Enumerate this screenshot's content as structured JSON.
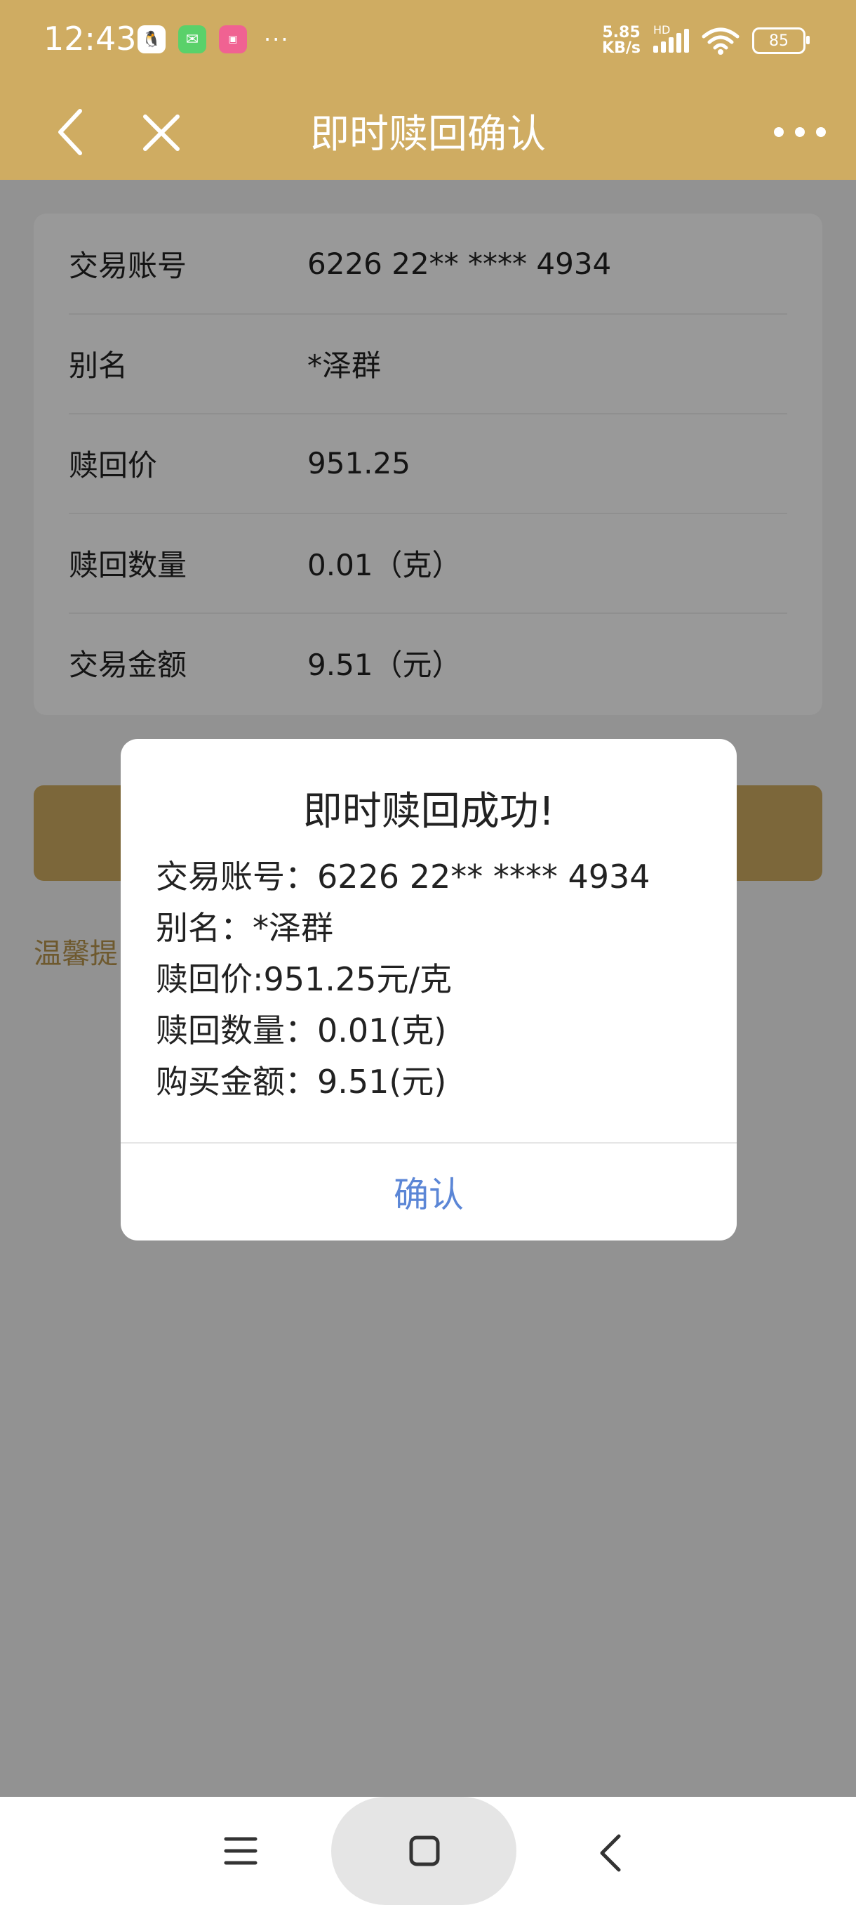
{
  "status_bar": {
    "time": "12:43",
    "speed_value": "5.85",
    "speed_unit": "KB/s",
    "network_label": "HD",
    "battery": "85",
    "more_notifications": "···"
  },
  "header": {
    "title": "即时赎回确认"
  },
  "details": {
    "rows": [
      {
        "label": "交易账号",
        "value": "6226 22** **** 4934"
      },
      {
        "label": "别名",
        "value": "*泽群"
      },
      {
        "label": "赎回价",
        "value": "951.25"
      },
      {
        "label": "赎回数量",
        "value": "0.01（克）"
      },
      {
        "label": "交易金额",
        "value": "9.51（元）"
      }
    ]
  },
  "tip": {
    "text": "温馨提"
  },
  "dialog": {
    "title": "即时赎回成功!",
    "lines": [
      "交易账号：6226 22** **** 4934",
      "别名：*泽群",
      "赎回价:951.25元/克",
      "赎回数量：0.01(克)",
      "购买金额：9.51(元)"
    ],
    "confirm_label": "确认"
  },
  "colors": {
    "brand": "#cfac62",
    "dialog_action": "#5b86d6"
  }
}
